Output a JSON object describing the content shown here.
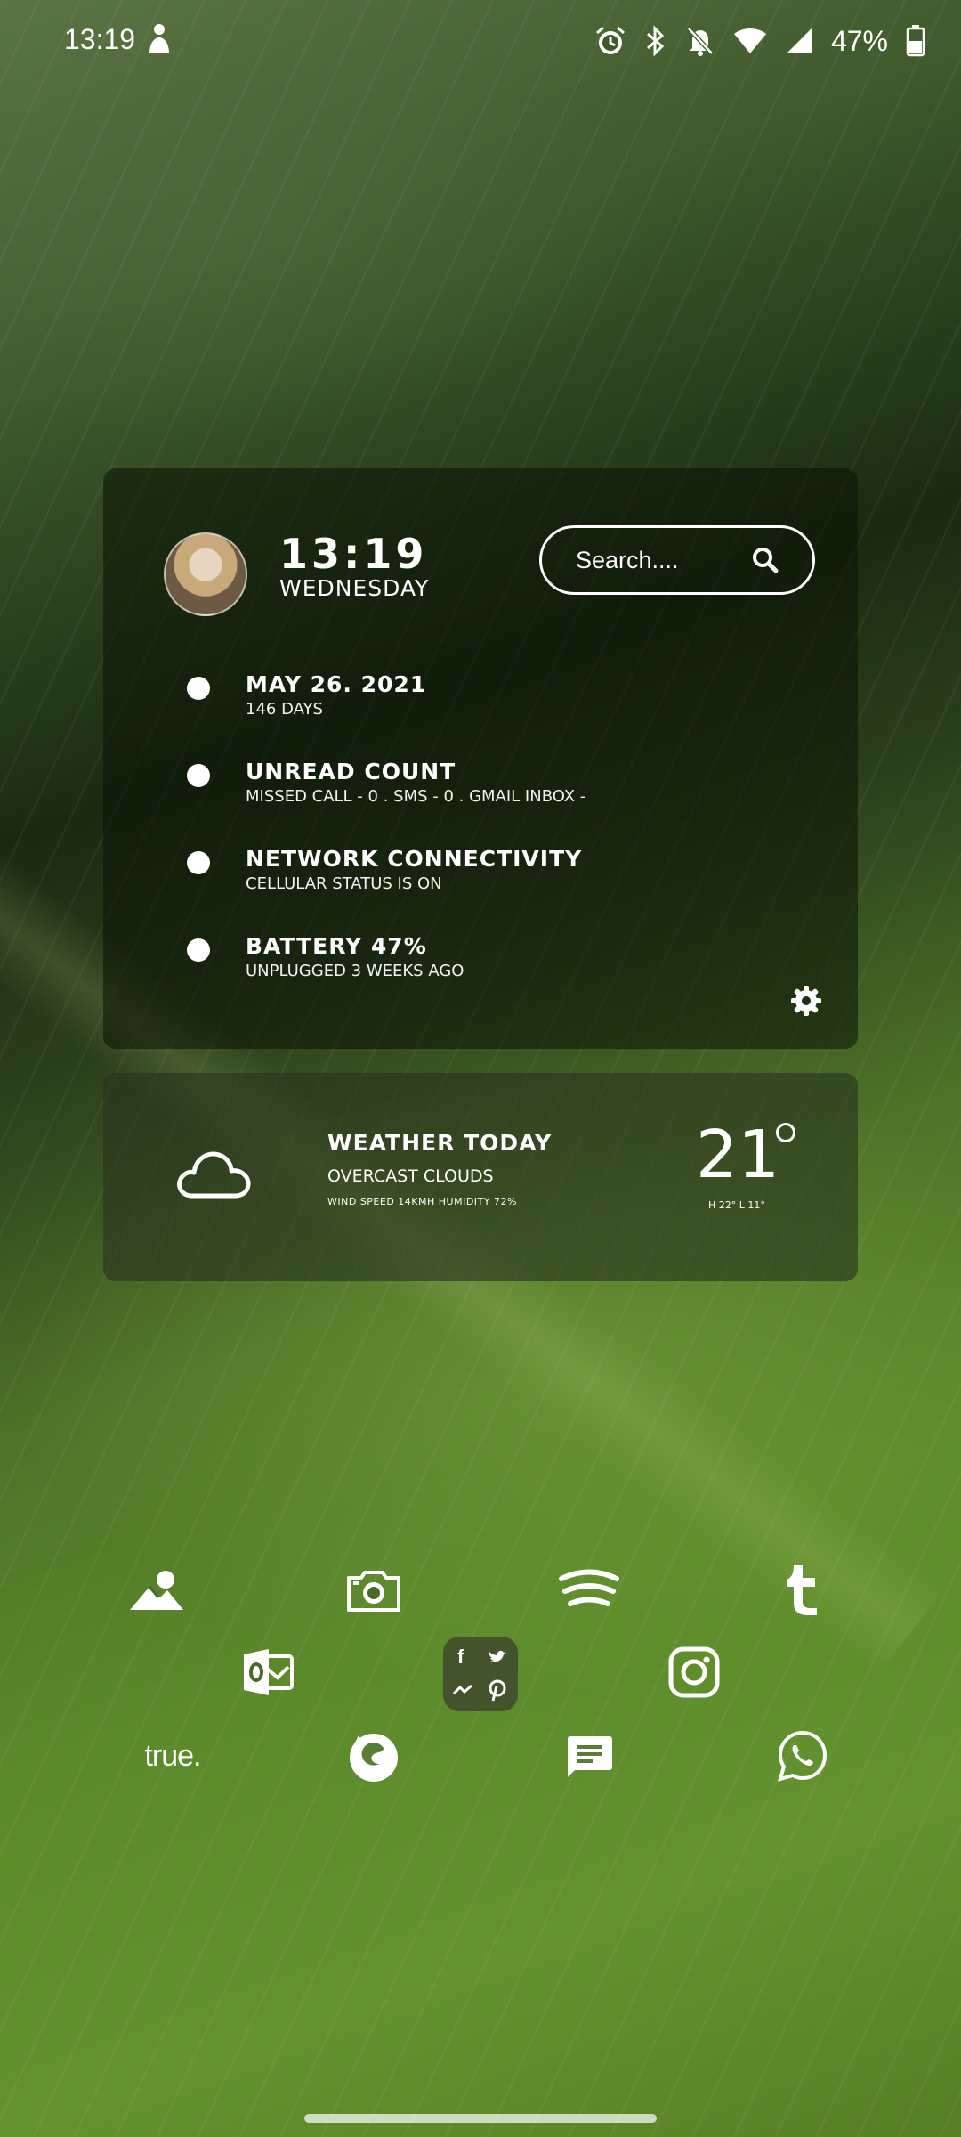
{
  "status_bar": {
    "time": "13:19",
    "battery_percent": "47%",
    "icons": [
      "person-icon",
      "alarm-icon",
      "bluetooth-icon",
      "bell-off-icon",
      "wifi-icon",
      "signal-icon",
      "battery-icon"
    ]
  },
  "widget": {
    "clock_time": "13:19",
    "clock_day": "WEDNESDAY",
    "search_placeholder": "Search....",
    "items": [
      {
        "title": "MAY 26. 2021",
        "sub": "146 DAYS"
      },
      {
        "title": "UNREAD COUNT",
        "sub": "MISSED CALL - 0  .  SMS - 0  .  GMAIL INBOX -"
      },
      {
        "title": "NETWORK CONNECTIVITY",
        "sub": "CELLULAR STATUS IS ON"
      },
      {
        "title": "BATTERY 47%",
        "sub": "UNPLUGGED 3 WEEKS AGO"
      }
    ]
  },
  "weather": {
    "title": "WEATHER TODAY",
    "description": "OVERCAST CLOUDS",
    "details": "WIND SPEED 14KMH  HUMIDITY 72%",
    "temperature": "21",
    "high_low": "H 22°  L 11°"
  },
  "apps": {
    "true_label": "true.",
    "folder_letters": [
      "f",
      "t",
      "m",
      "p"
    ],
    "icons": [
      "gallery-icon",
      "camera-icon",
      "spotify-icon",
      "tumblr-icon",
      "outlook-icon",
      "social-folder-icon",
      "instagram-icon",
      "true-icon",
      "firefox-icon",
      "messages-icon",
      "whatsapp-icon"
    ]
  }
}
